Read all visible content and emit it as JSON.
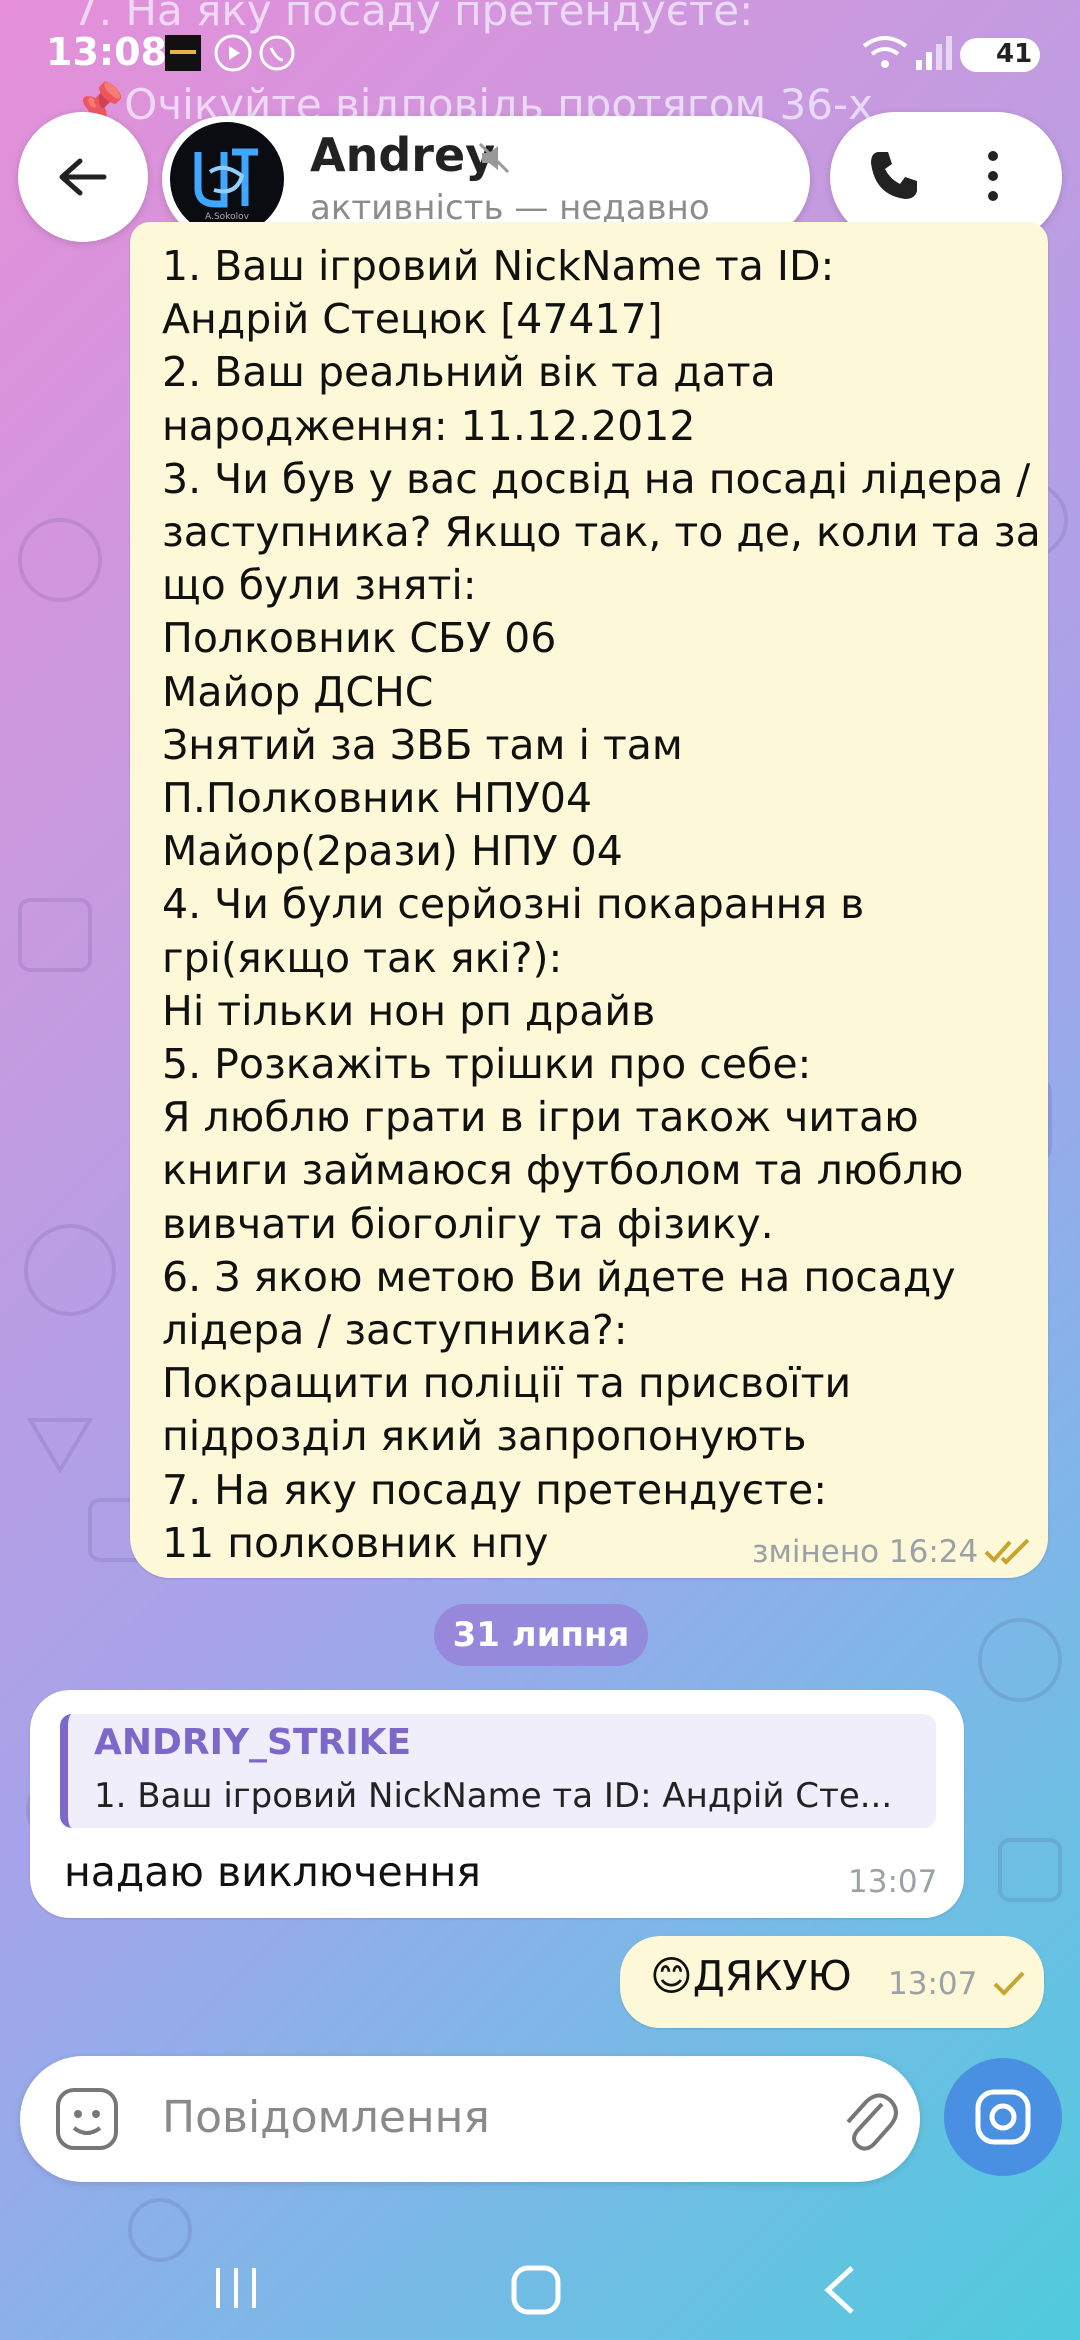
{
  "status_bar": {
    "time": "13:08",
    "battery": "41",
    "icons": [
      "app-notification-icon",
      "youtube-icon",
      "viber-icon",
      "wifi-icon",
      "signal-icon",
      "battery-icon"
    ]
  },
  "behind_text": {
    "line1": "7. На яку посаду претендуєте:",
    "line2": "📌Очікуйте відповідь протягом 36-х"
  },
  "header": {
    "name": "Andrey",
    "subtitle": "активність — недавно",
    "avatar_caption": "A.Sokolov"
  },
  "messages": {
    "big": {
      "lines": [
        "1. Ваш ігровий NickName та ID:",
        "Андрій Стецюк [47417]",
        "2. Ваш реальний вік та дата",
        "народження: 11.12.2012",
        "3. Чи був у вас досвід на посаді лідера /",
        "заступника? Якщо так, то де, коли та за",
        "що були зняті:",
        "Полковник СБУ 06",
        "Майор ДСНС",
        "Знятий за ЗВБ там і там",
        "П.Полковник НПУ04",
        "Майор(2рази) НПУ 04",
        "4. Чи були серйозні покарання в",
        "грі(якщо так які?):",
        "Ні тільки нон рп драйв",
        "5. Розкажіть трішки про себе:",
        "Я люблю грати в ігри також читаю",
        "книги займаюся футболом та люблю",
        "вивчати біоголігу та фізику.",
        "6. З якою метою Ви йдете на посаду",
        "лідера / заступника?:",
        "Покращити поліції та присвоїти",
        "підрозділ який запропонують",
        "7. На яку посаду претендуєте:",
        "11 полковник нпу"
      ],
      "meta": "змінено 16:24"
    },
    "date_separator": "31 липня",
    "reply": {
      "quote_name": "ANDRIY_STRIKE",
      "quote_text": "1. Ваш ігровий NickName та ID: Андрій Сте...",
      "text": "надаю виключення",
      "time": "13:07"
    },
    "thanks": {
      "text": "😊ДЯКУЮ",
      "time": "13:07"
    }
  },
  "input": {
    "placeholder": "Повідомлення"
  },
  "colors": {
    "accent": "#4a90e2",
    "outgoing_bubble": "#fdf8d7",
    "quote_accent": "#7b68c9"
  }
}
